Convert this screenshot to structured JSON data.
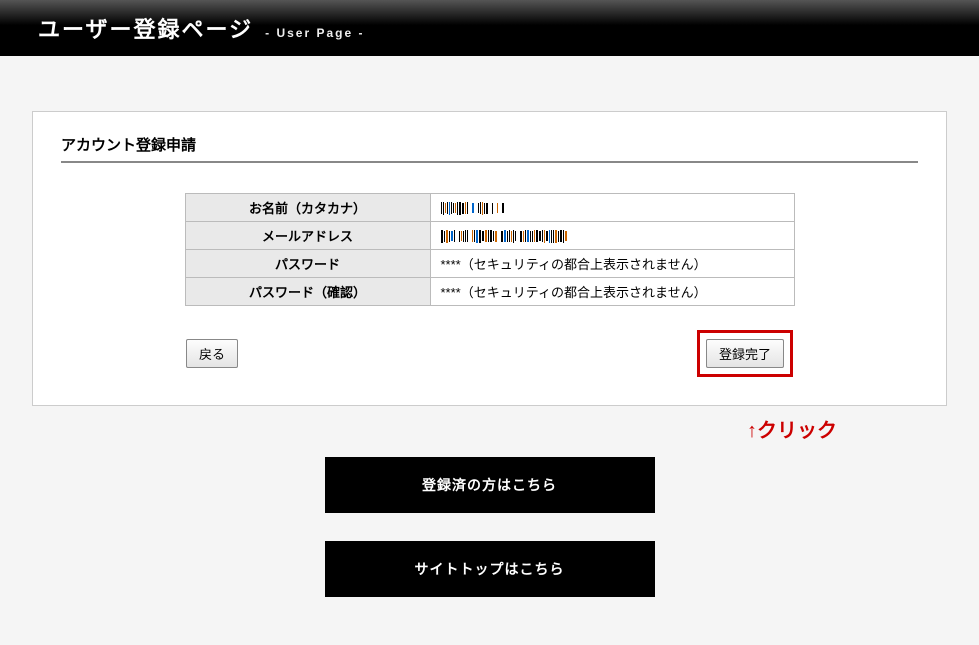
{
  "header": {
    "title": "ユーザー登録ページ",
    "subtitle": "- User Page -"
  },
  "form": {
    "section_title": "アカウント登録申請",
    "rows": [
      {
        "label": "お名前（カタカナ）",
        "value": "（入力内容）"
      },
      {
        "label": "メールアドレス",
        "value": "（入力内容）"
      },
      {
        "label": "パスワード",
        "value": "****（セキュリティの都合上表示されません）"
      },
      {
        "label": "パスワード（確認）",
        "value": "****（セキュリティの都合上表示されません）"
      }
    ],
    "back_label": "戻る",
    "submit_label": "登録完了"
  },
  "annotation": {
    "click_here": "↑クリック"
  },
  "nav": {
    "already_registered": "登録済の方はこちら",
    "site_top": "サイトトップはこちら"
  }
}
